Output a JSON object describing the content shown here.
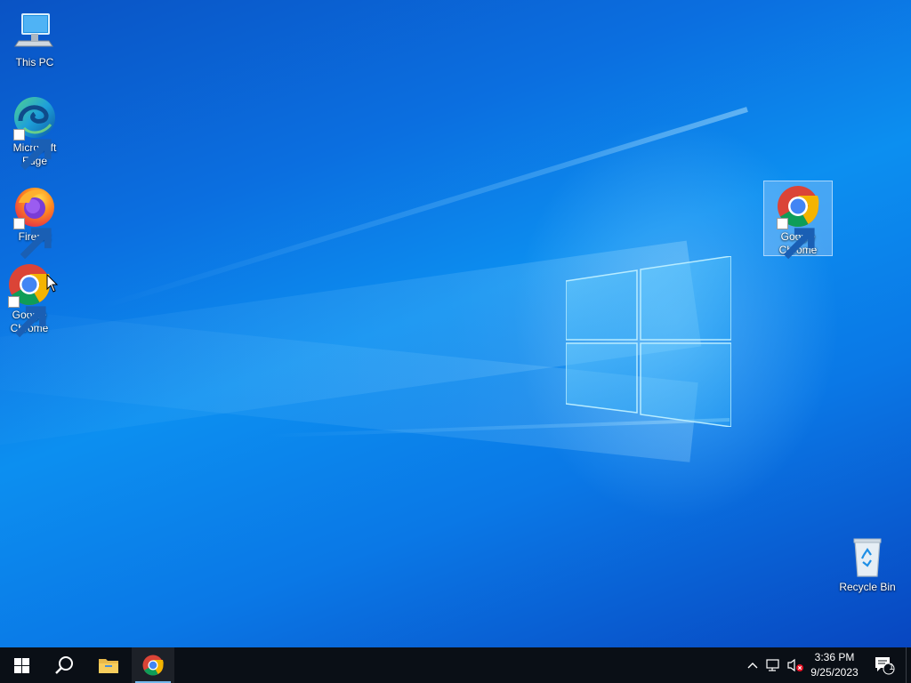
{
  "desktop": {
    "icons": [
      {
        "label": "This PC",
        "icon": "computer-icon",
        "shortcut": false
      },
      {
        "label": "Microsoft Edge",
        "icon": "edge-icon",
        "shortcut": true
      },
      {
        "label": "Firefox",
        "icon": "firefox-icon",
        "shortcut": true
      },
      {
        "label": "Google Chrome",
        "icon": "chrome-icon",
        "shortcut": true
      },
      {
        "label": "Google Chrome",
        "icon": "chrome-icon",
        "shortcut": true,
        "selected": true
      },
      {
        "label": "Recycle Bin",
        "icon": "recycle-bin-icon",
        "shortcut": false
      }
    ]
  },
  "taskbar": {
    "start": {
      "icon": "windows-logo-icon"
    },
    "search": {
      "icon": "search-icon"
    },
    "pinned": [
      {
        "icon": "file-explorer-icon"
      },
      {
        "icon": "chrome-icon",
        "active": true
      }
    ],
    "tray": {
      "icons": [
        "chevron-up-icon",
        "network-icon",
        "volume-muted-icon"
      ],
      "time": "3:36 PM",
      "date": "9/25/2023",
      "notifications": {
        "icon": "action-center-icon",
        "count": "1"
      }
    }
  },
  "colors": {
    "taskbar": "#0a0f16",
    "accent": "#76b9ed",
    "desktop_base": "#0b6fe0"
  }
}
